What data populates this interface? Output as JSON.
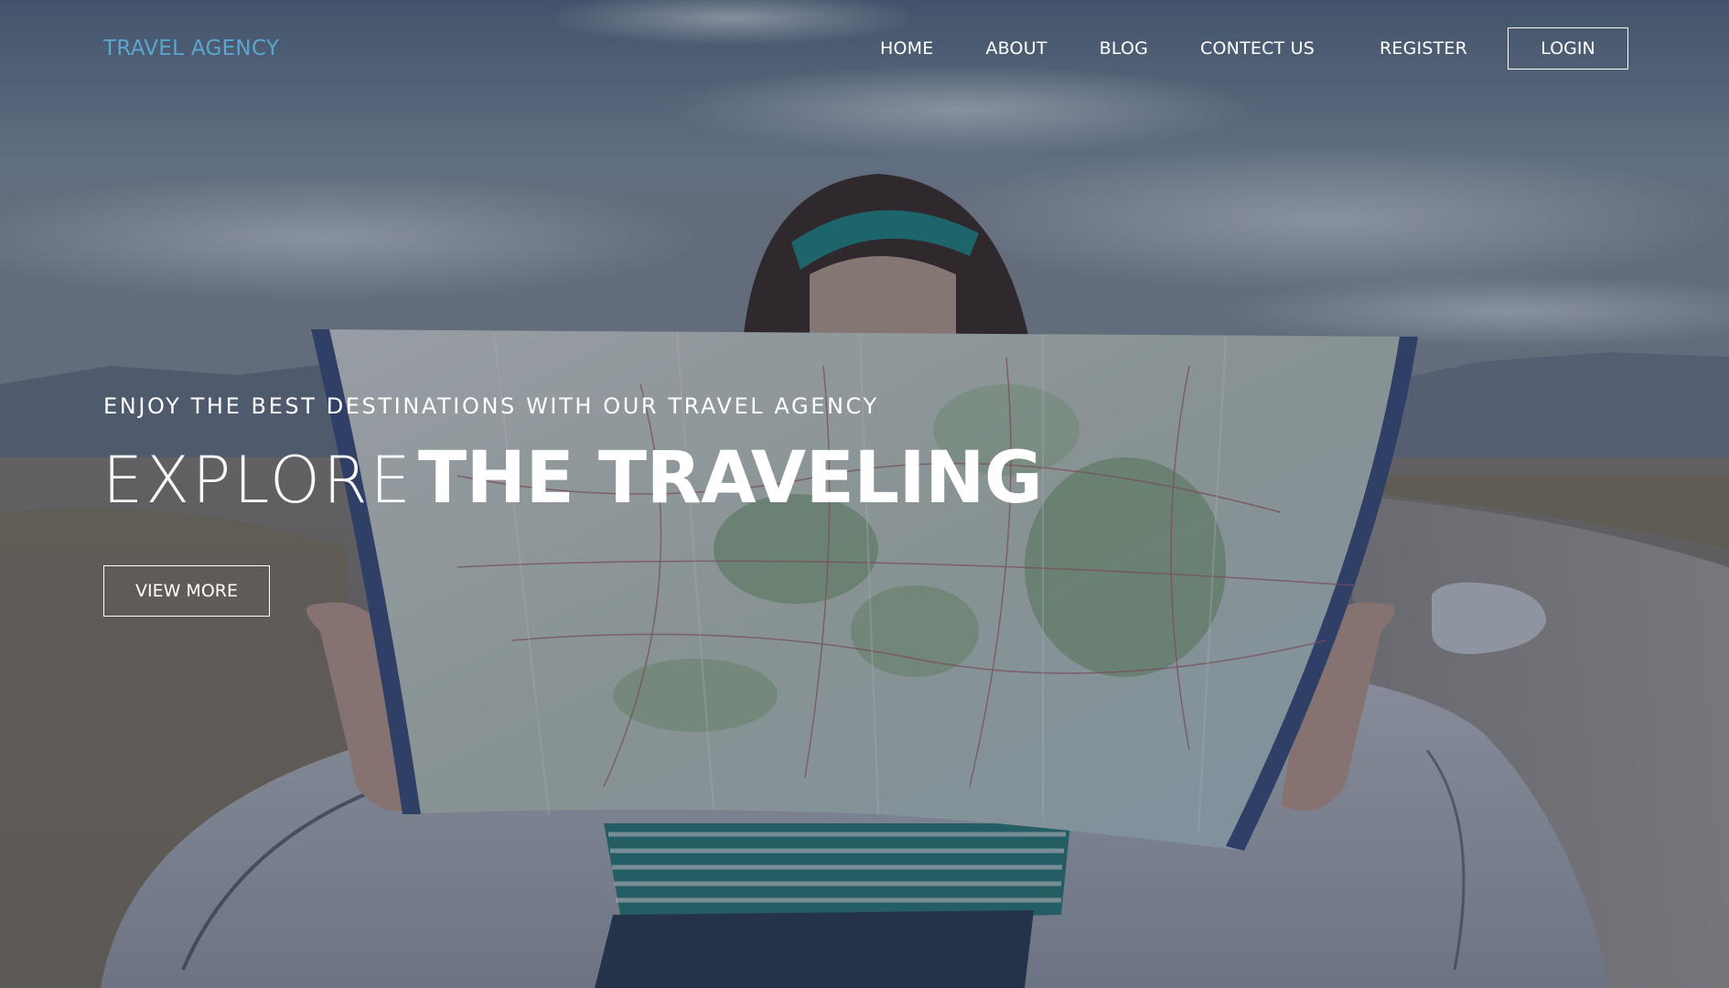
{
  "brand": {
    "name": "TRAVEL AGENCY",
    "color": "#5aa6cf"
  },
  "nav": {
    "home": "HOME",
    "about": "ABOUT",
    "blog": "BLOG",
    "contact": "CONTECT US",
    "register": "REGISTER",
    "login": "LOGIN"
  },
  "hero": {
    "tagline": "ENJOY THE BEST DESTINATIONS WITH OUR TRAVEL AGENCY",
    "headline_light": "EXPLORE",
    "headline_bold": "THE TRAVELING",
    "cta": "VIEW MORE"
  },
  "background": {
    "image": "woman-reading-map-photo",
    "overlay_color": "#1c283e"
  }
}
